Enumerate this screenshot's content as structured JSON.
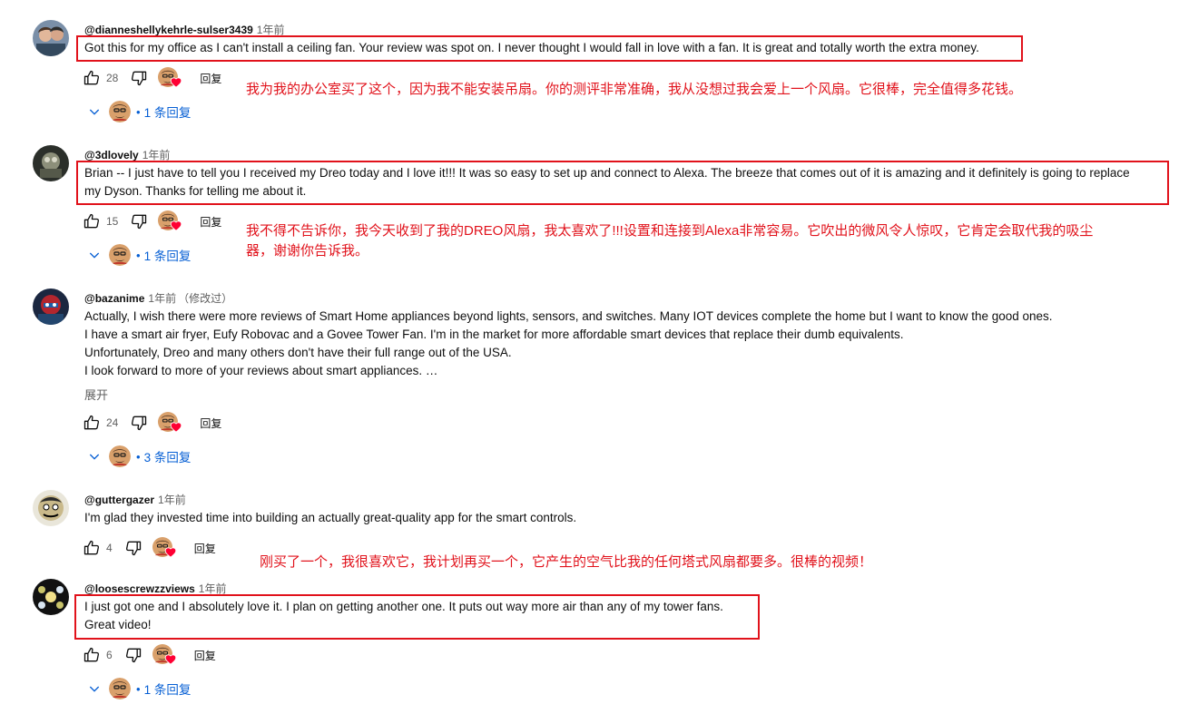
{
  "comments": [
    {
      "author": "@dianneshellykehrle-sulser3439",
      "time": "1年前",
      "edited": "",
      "lines": [
        "Got this for my office as I can't install a ceiling fan. Your review was spot on. I never thought I would fall in love with a fan. It is great and totally worth the extra money."
      ],
      "likes": "28",
      "reply_label": "回复",
      "replies_label": "1 条回复",
      "translation": [
        "我为我的办公室买了这个，因为我不能安装吊扇。你的测评非常准确，我从没想过我会爱上一个风扇。它很棒，完全值得多花钱。"
      ]
    },
    {
      "author": "@3dlovely",
      "time": "1年前",
      "edited": "",
      "lines": [
        "Brian -- I just have to tell you I received my Dreo today and I love it!!!  It was so easy to set up and connect to Alexa.  The breeze that comes out of it is amazing and it definitely is going to replace",
        "my Dyson.  Thanks for telling me about it."
      ],
      "likes": "15",
      "reply_label": "回复",
      "replies_label": "1 条回复",
      "translation": [
        "我不得不告诉你，我今天收到了我的DREO风扇，我太喜欢了!!!设置和连接到Alexa非常容易。它吹出的微风令人惊叹，它肯定会取代我的吸尘",
        "器，谢谢你告诉我。"
      ]
    },
    {
      "author": "@bazanime",
      "time": "1年前",
      "edited": "（修改过）",
      "lines": [
        "Actually, I wish there were more reviews of Smart Home appliances beyond lights, sensors, and switches. Many IOT devices complete the home but I want to know the good ones.",
        "I have a smart air fryer, Eufy Robovac and a Govee Tower Fan. I'm in the market for more affordable smart devices that replace their dumb equivalents.",
        "Unfortunately, Dreo and many others don't have their full range out of the USA.",
        "I look forward to more of your reviews about smart appliances. …"
      ],
      "expand_label": "展开",
      "likes": "24",
      "reply_label": "回复",
      "replies_label": "3 条回复",
      "translation": []
    },
    {
      "author": "@guttergazer",
      "time": "1年前",
      "edited": "",
      "lines": [
        "I'm glad they invested time into building an actually great-quality app for the smart controls."
      ],
      "likes": "4",
      "reply_label": "回复",
      "replies_label": "",
      "translation": []
    },
    {
      "author": "@loosescrewzzviews",
      "time": "1年前",
      "edited": "",
      "lines": [
        "I just got one and I absolutely love it. I plan on getting another one. It puts out way more air than any of my tower fans.",
        "Great video!"
      ],
      "likes": "6",
      "reply_label": "回复",
      "replies_label": "1 条回复",
      "translation": [
        "刚买了一个，我很喜欢它，我计划再买一个，它产生的空气比我的任何塔式风扇都要多。很棒的视频！"
      ]
    }
  ],
  "colors": {
    "annotation": "#e1121b",
    "link": "#065fd4",
    "secondary_text": "#606060",
    "heart": "#ff0033"
  },
  "icons": [
    "thumb-up-icon",
    "thumb-down-icon",
    "creator-heart-icon",
    "chevron-down-icon",
    "avatar"
  ]
}
